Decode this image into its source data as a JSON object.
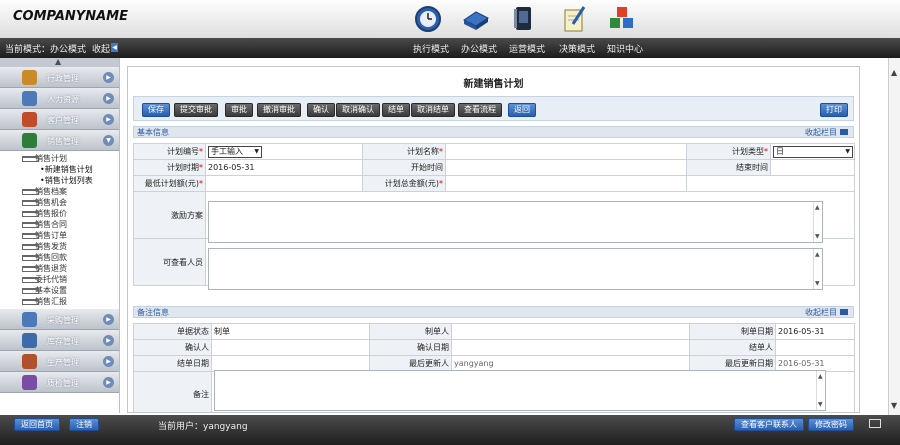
{
  "header": {
    "company": "COMPANYNAME",
    "mode_label": "当前模式：",
    "mode_value": "办公模式",
    "collapse": "收起",
    "modes": [
      "执行模式",
      "办公模式",
      "运营模式",
      "决策模式",
      "知识中心"
    ]
  },
  "sidebar": {
    "groups_top": [
      {
        "label": "行政管理",
        "color": "#c98a2a"
      },
      {
        "label": "人力资源",
        "color": "#4d79b8"
      },
      {
        "label": "客户管理",
        "color": "#c24b2a"
      },
      {
        "label": "销售管理",
        "color": "#2f7d3a"
      }
    ],
    "plan": "销售计划",
    "plan_subs": [
      "•新建销售计划",
      "•销售计划列表"
    ],
    "items": [
      "销售档案",
      "销售机会",
      "销售报价",
      "销售合同",
      "销售订单",
      "销售发货",
      "销售回款",
      "销售退货",
      "委托代销",
      "基本设置",
      "销售汇报"
    ],
    "groups_bottom": [
      {
        "label": "采购管理",
        "color": "#4d79b8"
      },
      {
        "label": "库存管理",
        "color": "#3d6aa8"
      },
      {
        "label": "生产管理",
        "color": "#b0502c"
      },
      {
        "label": "质检管理",
        "color": "#7a4ca5"
      }
    ]
  },
  "main": {
    "title": "新建销售计划",
    "buttons": [
      "保存",
      "提交审批",
      "审批",
      "撤消审批",
      "确认",
      "取消确认",
      "结单",
      "取消结单",
      "查看流程",
      "返回"
    ],
    "print": "打印",
    "sec1": "基本信息",
    "sec2": "备注信息",
    "collapse_bar": "收起栏目",
    "f": {
      "plan_no_label": "计划编号",
      "plan_no_value": "手工输入",
      "plan_name_label": "计划名称",
      "plan_type_label": "计划类型",
      "plan_type_value": "日",
      "plan_time_label": "计划时期",
      "plan_time_value": "2016-05-31",
      "start_label": "开始时间",
      "end_label": "结束时间",
      "min_amount_label": "最低计划额(元)",
      "total_amount_label": "计划总金额(元)",
      "incentive_label": "激励方案",
      "viewers_label": "可查看人员"
    },
    "r": {
      "status_label": "单据状态",
      "status_value": "制单",
      "creator_label": "制单人",
      "create_date_label": "制单日期",
      "create_date_value": "2016-05-31",
      "confirmer_label": "确认人",
      "confirm_date_label": "确认日期",
      "closer_label": "结单人",
      "close_date_label": "结单日期",
      "updater_label": "最后更新人",
      "updater_value": "yangyang",
      "update_date_label": "最后更新日期",
      "update_date_value": "2016-05-31",
      "remark_label": "备注"
    }
  },
  "footer": {
    "home": "返回首页",
    "logout": "注销",
    "current_user_label": "当前用户：",
    "current_user": "yangyang",
    "view_contacts": "查看客户联系人",
    "change_password": "修改密码"
  }
}
